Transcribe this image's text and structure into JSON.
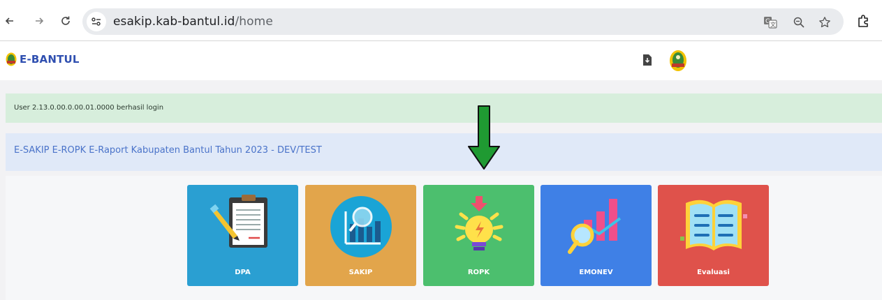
{
  "browser": {
    "url_host": "esakip.kab-bantul.id",
    "url_path": "/home"
  },
  "header": {
    "brand": "E-BANTUL"
  },
  "alert": {
    "message": "User 2.13.0.00.0.00.01.0000 berhasil login"
  },
  "info": {
    "title": "E-SAKIP E-ROPK E-Raport Kabupaten Bantul Tahun 2023 - DEV/TEST"
  },
  "tiles": [
    {
      "label": "DPA",
      "color": "#2a9fd2"
    },
    {
      "label": "SAKIP",
      "color": "#e2a54b"
    },
    {
      "label": "ROPK",
      "color": "#4cbf6e"
    },
    {
      "label": "EMONEV",
      "color": "#3f80e6"
    },
    {
      "label": "Evaluasi",
      "color": "#df524b"
    }
  ],
  "annotation": {
    "arrow_color": "#1f9a32"
  }
}
